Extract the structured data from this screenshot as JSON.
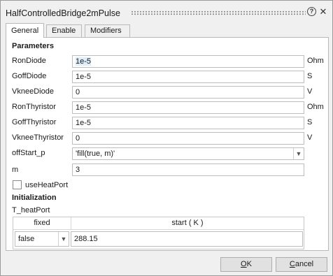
{
  "window": {
    "title": "HalfControlledBridge2mPulse",
    "help_glyph": "?",
    "close_glyph": "✕"
  },
  "tabs": [
    {
      "label": "General",
      "active": true
    },
    {
      "label": "Enable",
      "active": false
    },
    {
      "label": "Modifiers",
      "active": false
    }
  ],
  "parameters": {
    "heading": "Parameters",
    "rows": [
      {
        "label": "RonDiode",
        "value": "1e-5",
        "unit": "Ohm"
      },
      {
        "label": "GoffDiode",
        "value": "1e-5",
        "unit": "S"
      },
      {
        "label": "VkneeDiode",
        "value": "0",
        "unit": "V"
      },
      {
        "label": "RonThyristor",
        "value": "1e-5",
        "unit": "Ohm"
      },
      {
        "label": "GoffThyristor",
        "value": "1e-5",
        "unit": "S"
      },
      {
        "label": "VkneeThyristor",
        "value": "0",
        "unit": "V"
      }
    ],
    "offStart": {
      "label": "offStart_p",
      "value": "'fill(true, m)'"
    },
    "m": {
      "label": "m",
      "value": "3"
    },
    "useHeatPort": {
      "label": "useHeatPort",
      "checked": false
    }
  },
  "initialization": {
    "heading": "Initialization",
    "variable_label": "T_heatPort",
    "columns": [
      "fixed",
      "start ( K )"
    ],
    "row": {
      "fixed": "false",
      "start": "288.15"
    }
  },
  "buttons": {
    "ok": {
      "mnemonic": "O",
      "rest": "K"
    },
    "cancel": {
      "mnemonic": "C",
      "rest": "ancel"
    }
  },
  "colors": {
    "dialog_bg": "#f0f0f0",
    "panel_bg": "#ffffff",
    "field_border": "#bdbdbd",
    "selection_highlight": "#ddeefa"
  },
  "icons": {
    "help": "help-icon",
    "close": "close-icon",
    "dropdown": "chevron-down-icon"
  }
}
